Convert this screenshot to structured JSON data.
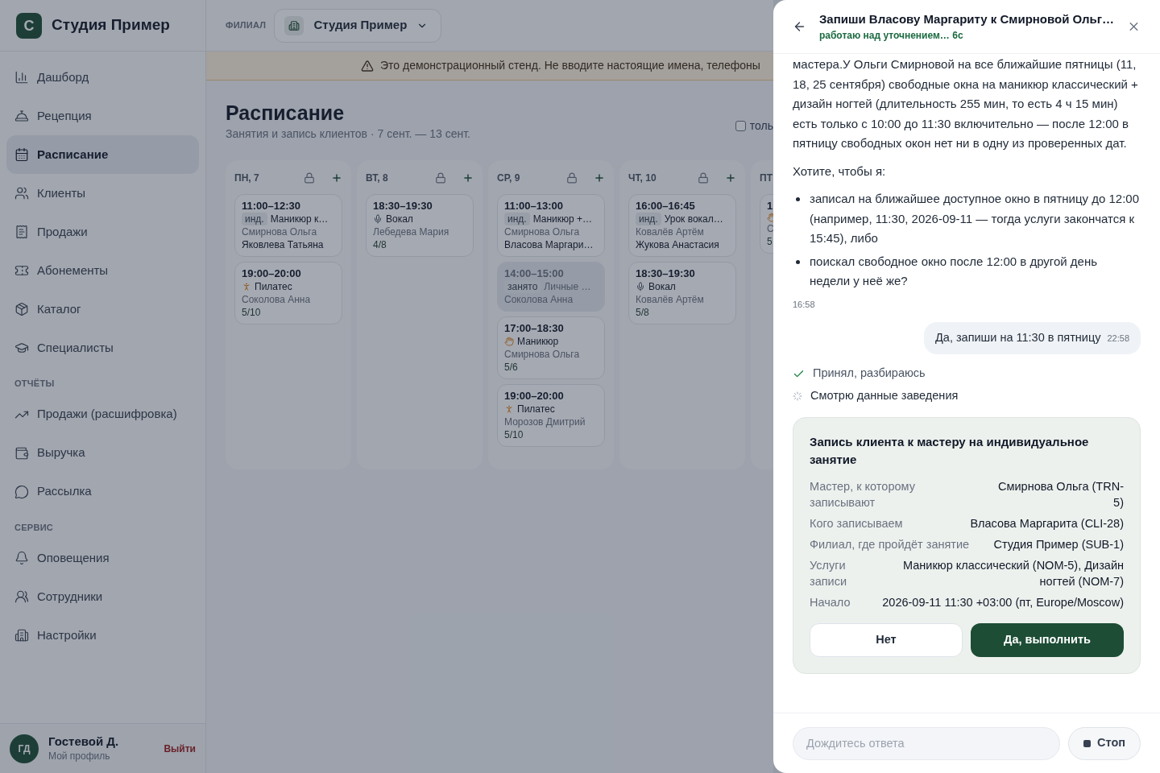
{
  "sidebar": {
    "brand": {
      "initial": "С",
      "name": "Студия Пример"
    },
    "groups": [
      {
        "items": [
          {
            "label": "Дашборд",
            "selected": false
          },
          {
            "label": "Рецепция",
            "selected": false
          },
          {
            "label": "Расписание",
            "selected": true
          },
          {
            "label": "Клиенты",
            "selected": false
          },
          {
            "label": "Продажи",
            "selected": false
          },
          {
            "label": "Абонементы",
            "selected": false
          },
          {
            "label": "Каталог",
            "selected": false
          },
          {
            "label": "Специалисты",
            "selected": false
          }
        ]
      },
      {
        "title": "ОТЧЁТЫ",
        "items": [
          {
            "label": "Продажи (расшифровка)",
            "selected": false
          },
          {
            "label": "Выручка",
            "selected": false
          },
          {
            "label": "Рассылка",
            "selected": false
          }
        ]
      },
      {
        "title": "СЕРВИС",
        "items": [
          {
            "label": "Оповещения",
            "selected": false
          },
          {
            "label": "Сотрудники",
            "selected": false
          },
          {
            "label": "Настройки",
            "selected": false
          }
        ]
      }
    ],
    "user": {
      "initials": "ГД",
      "name": "Гостевой Д.",
      "subtitle": "Мой профиль",
      "logout": "Выйти"
    }
  },
  "topbar": {
    "branch_label": "ФИЛИАЛ",
    "branch_value": "Студия Пример"
  },
  "banner": {
    "text": "Это демонстрационный стенд. Не вводите настоящие имена, телефоны"
  },
  "schedule": {
    "title": "Расписание",
    "subtitle": "Занятия и запись клиентов · 7 сент. — 13 сент.",
    "filter": {
      "label": "толь",
      "checked": false
    },
    "days": [
      {
        "label": "ПН, 7",
        "controls": true,
        "events": [
          {
            "kind": "individual",
            "time": "11:00–12:30",
            "badge": "инд.",
            "name": "Маникюр к…",
            "trainer": "Смирнова Ольга",
            "client": "Яковлева Татьяна"
          },
          {
            "kind": "pilates",
            "time": "19:00–20:00",
            "name": "Пилатес",
            "trainer": "Соколова Анна",
            "count": "5/10"
          }
        ]
      },
      {
        "label": "ВТ, 8",
        "controls": true,
        "events": [
          {
            "kind": "vocal",
            "time": "18:30–19:30",
            "name": "Вокал",
            "trainer": "Лебедева Мария",
            "count": "4/8"
          }
        ]
      },
      {
        "label": "СР, 9",
        "controls": true,
        "events": [
          {
            "kind": "individual",
            "time": "11:00–13:00",
            "badge": "инд.",
            "name": "Маникюр +…",
            "trainer": "Смирнова Ольга",
            "client": "Власова Маргари…"
          },
          {
            "kind": "busy",
            "time": "14:00–15:00",
            "badge": "занято",
            "name": "Личные …",
            "trainer": "Соколова Анна"
          },
          {
            "kind": "manicure",
            "time": "17:00–18:30",
            "name": "Маникюр",
            "trainer": "Смирнова Ольга",
            "count": "5/6"
          },
          {
            "kind": "pilates",
            "time": "19:00–20:00",
            "name": "Пилатес",
            "trainer": "Морозов Дмитрий",
            "count": "5/10"
          }
        ]
      },
      {
        "label": "ЧТ, 10",
        "controls": true,
        "events": [
          {
            "kind": "individual",
            "time": "16:00–16:45",
            "badge": "инд.",
            "name": "Урок вокал…",
            "trainer": "Ковалёв Артём",
            "client": "Жукова Анастасия"
          },
          {
            "kind": "vocal",
            "time": "18:30–19:30",
            "name": "Вокал",
            "trainer": "Ковалёв Артём",
            "count": "5/8"
          }
        ]
      },
      {
        "label": "ПТ",
        "events": [
          {
            "kind": "manicure",
            "time": "1",
            "trainer": "С",
            "count": "5"
          }
        ]
      }
    ]
  },
  "assistant": {
    "title": "Запиши Власову Маргариту к Смирновой Ольг…",
    "status": "работаю над уточнением… 6с",
    "messages": [
      {
        "kind": "assistant",
        "paragraphs": [
          "мастера.У Ольги Смирновой на все ближайшие пятницы (11, 18, 25 сентября) свободные окна на маникюр классический + дизайн ногтей (длительность 255 мин, то есть 4 ч 15 мин) есть только с 10:00 до 11:30 включительно — после 12:00 в пятницу свободных окон нет ни в одну из проверенных дат.",
          "Хотите, чтобы я:"
        ],
        "bullets": [
          "записал на ближайшее доступное окно в пятницу до 12:00 (например, 11:30, 2026-09-11 — тогда услуги закончатся к 15:45), либо",
          "поискал свободное окно после 12:00 в другой день недели у неё же?"
        ],
        "time": "16:58"
      },
      {
        "kind": "user",
        "text": "Да, запиши на 11:30 в пятницу",
        "time": "22:58"
      }
    ],
    "steps": [
      {
        "label": "Принял, разбираюсь",
        "done": true
      },
      {
        "label": "Смотрю данные заведения",
        "done": false
      }
    ],
    "confirm": {
      "title": "Запись клиента к мастеру на индивидуальное занятие",
      "rows": [
        {
          "label": "Мастер, к которому записывают",
          "value": "Смирнова Ольга (TRN-5)"
        },
        {
          "label": "Кого записываем",
          "value": "Власова Маргарита (CLI-28)"
        },
        {
          "label": "Филиал, где пройдёт занятие",
          "value": "Студия Пример (SUB-1)"
        },
        {
          "label": "Услуги записи",
          "value": "Маникюр классический (NOM-5), Дизайн ногтей (NOM-7)"
        },
        {
          "label": "Начало",
          "value": "2026-09-11 11:30 +03:00 (пт, Europe/Moscow)"
        }
      ],
      "cancel": "Нет",
      "accept": "Да, выполнить"
    },
    "composer": {
      "placeholder": "Дождитесь ответа",
      "stop": "Стоп"
    }
  }
}
